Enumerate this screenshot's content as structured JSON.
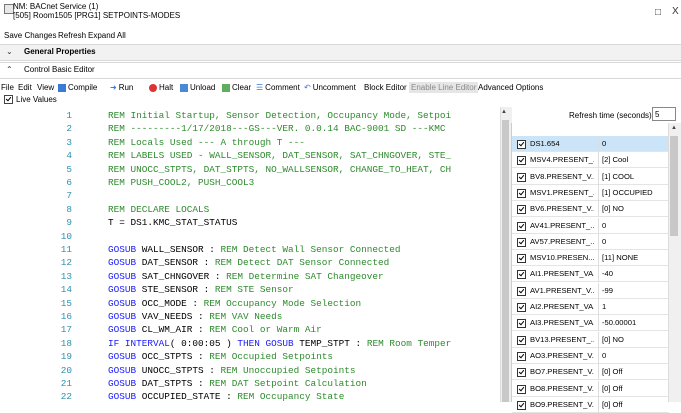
{
  "window": {
    "title_line1": "NM: BACnet Service (1)",
    "title_line2": "[505] Room1505 [PRG1] SETPOINTS-MODES",
    "maximize_icon": "□",
    "close_icon": "X"
  },
  "menu": {
    "save_changes": "Save Changes",
    "refresh": "Refresh",
    "expand_all": "Expand All"
  },
  "sections": {
    "general_properties": "General Properties",
    "control_basic_editor": "Control Basic Editor"
  },
  "toolbar": {
    "file": "File",
    "edit": "Edit",
    "view": "View",
    "compile": "Compile",
    "run": "Run",
    "halt": "Halt",
    "unload": "Unload",
    "clear": "Clear",
    "comment": "Comment",
    "uncomment": "Uncomment",
    "block_editor": "Block Editor",
    "enable_line_editor": "Enable Line Editor",
    "advanced_options": "Advanced Options"
  },
  "live_values": {
    "label": "Live Values",
    "checked": true
  },
  "editor": {
    "lines": [
      {
        "n": "1",
        "text": "REM Initial Startup, Sensor Detection, Occupancy Mode, Setpoi",
        "style": "comment"
      },
      {
        "n": "2",
        "text": "REM ---------1/17/2018---GS---VER. 0.0.14 BAC-9001 SD ---KMC",
        "style": "comment"
      },
      {
        "n": "3",
        "text": "REM Locals Used --- A through T ---",
        "style": "comment"
      },
      {
        "n": "4",
        "text": "REM LABELS USED - WALL_SENSOR, DAT_SENSOR, SAT_CHNGOVER, STE_",
        "style": "comment"
      },
      {
        "n": "5",
        "text": "REM UNOCC_STPTS, DAT_STPTS, NO_WALLSENSOR, CHANGE_TO_HEAT, CH",
        "style": "comment"
      },
      {
        "n": "6",
        "text": "REM PUSH_COOL2, PUSH_COOL3",
        "style": "comment"
      },
      {
        "n": "7",
        "text": "",
        "style": "plain"
      },
      {
        "n": "8",
        "text": "REM DECLARE LOCALS",
        "style": "comment"
      },
      {
        "n": "9",
        "text": "T = DS1.KMC_STAT_STATUS",
        "style": "plain"
      },
      {
        "n": "10",
        "text": "",
        "style": "plain"
      },
      {
        "n": "11",
        "kw": "GOSUB",
        "rest": " WALL_SENSOR : ",
        "cmt": "REM Detect Wall Sensor Connected"
      },
      {
        "n": "12",
        "kw": "GOSUB",
        "rest": " DAT_SENSOR : ",
        "cmt": "REM Detect DAT Sensor Connected"
      },
      {
        "n": "13",
        "kw": "GOSUB",
        "rest": " SAT_CHNGOVER : ",
        "cmt": "REM Determine SAT Changeover"
      },
      {
        "n": "14",
        "kw": "GOSUB",
        "rest": " STE_SENSOR : ",
        "cmt": "REM STE Sensor"
      },
      {
        "n": "15",
        "kw": "GOSUB",
        "rest": " OCC_MODE : ",
        "cmt": "REM Occupancy Mode Selection"
      },
      {
        "n": "16",
        "kw": "GOSUB",
        "rest": " VAV_NEEDS : ",
        "cmt": "REM VAV Needs"
      },
      {
        "n": "17",
        "kw": "GOSUB",
        "rest": " CL_WM_AIR : ",
        "cmt": "REM Cool or Warm Air"
      },
      {
        "n": "18",
        "kw": "IF INTERVAL",
        "rest": "( 0:00:05 ) ",
        "kw2": "THEN GOSUB",
        "rest2": " TEMP_STPT : ",
        "cmt": "REM Room Temper"
      },
      {
        "n": "19",
        "kw": "GOSUB",
        "rest": " OCC_STPTS : ",
        "cmt": "REM Occupied Setpoints"
      },
      {
        "n": "20",
        "kw": "GOSUB",
        "rest": " UNOCC_STPTS : ",
        "cmt": "REM Unoccupied Setpoints"
      },
      {
        "n": "21",
        "kw": "GOSUB",
        "rest": " DAT_STPTS : ",
        "cmt": "REM DAT Setpoint Calculation"
      },
      {
        "n": "22",
        "kw": "GOSUB",
        "rest": " OCCUPIED_STATE : ",
        "cmt": "REM Occupancy State"
      }
    ]
  },
  "refresh": {
    "label": "Refresh time (seconds)",
    "value": "5"
  },
  "variables": [
    {
      "name": "DS1.654",
      "value": "0",
      "selected": true
    },
    {
      "name": "MSV4.PRESENT_...",
      "value": "[2] Cool"
    },
    {
      "name": "BV8.PRESENT_V...",
      "value": "[1] COOL"
    },
    {
      "name": "MSV1.PRESENT_...",
      "value": "[1] OCCUPIED"
    },
    {
      "name": "BV6.PRESENT_V...",
      "value": "[0] NO"
    },
    {
      "name": "AV41.PRESENT_...",
      "value": "0"
    },
    {
      "name": "AV57.PRESENT_...",
      "value": "0"
    },
    {
      "name": "MSV10.PRESEN...",
      "value": "[11] NONE"
    },
    {
      "name": "AI1.PRESENT_VA...",
      "value": "-40"
    },
    {
      "name": "AV1.PRESENT_V...",
      "value": "-99"
    },
    {
      "name": "AI2.PRESENT_VA...",
      "value": "1"
    },
    {
      "name": "AI3.PRESENT_VA...",
      "value": "-50.00001"
    },
    {
      "name": "BV13.PRESENT_...",
      "value": "[0] NO"
    },
    {
      "name": "AO3.PRESENT_V...",
      "value": "0"
    },
    {
      "name": "BO7.PRESENT_V...",
      "value": "[0] Off"
    },
    {
      "name": "BO8.PRESENT_V...",
      "value": "[0] Off"
    },
    {
      "name": "BO9.PRESENT_V...",
      "value": "[0] Off"
    }
  ],
  "colors": {
    "comment": "#2e8b2e",
    "keyword": "#1a1aff",
    "line_number": "#2b91af",
    "selection": "#cce4f7"
  }
}
